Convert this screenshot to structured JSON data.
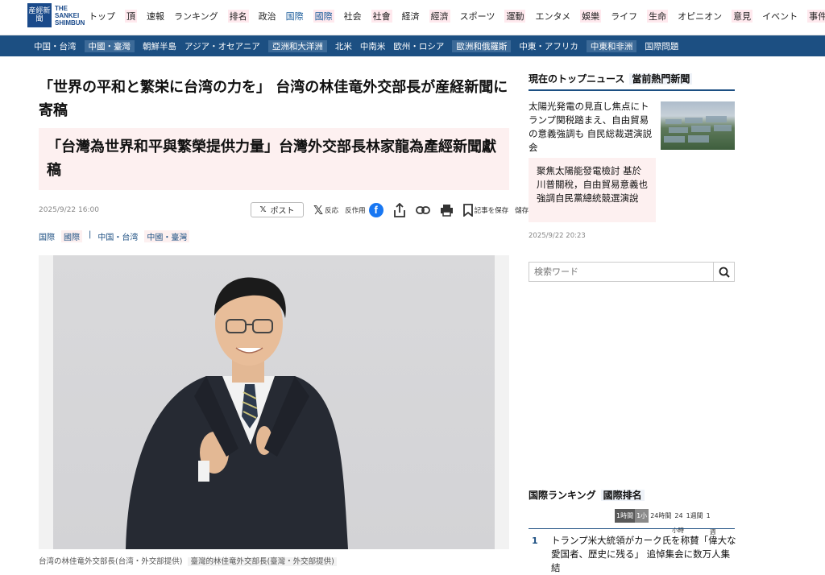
{
  "logo": {
    "kanji": "産經新聞",
    "en": [
      "THE",
      "SANKEI",
      "SHIMBUN"
    ]
  },
  "nav": [
    {
      "label": "トップ",
      "hl": false
    },
    {
      "label": "頂",
      "hl": true
    },
    {
      "label": "速報",
      "hl": false
    },
    {
      "label": "ランキング",
      "hl": false
    },
    {
      "label": "排名",
      "hl": true
    },
    {
      "label": "政治",
      "hl": false
    },
    {
      "label": "国際",
      "hl": false,
      "active": true
    },
    {
      "label": "國際",
      "hl": true,
      "active": true
    },
    {
      "label": "社会",
      "hl": false
    },
    {
      "label": "社會",
      "hl": true
    },
    {
      "label": "経済",
      "hl": false
    },
    {
      "label": "經濟",
      "hl": true
    },
    {
      "label": "スポーツ",
      "hl": false
    },
    {
      "label": "運動",
      "hl": true
    },
    {
      "label": "エンタメ",
      "hl": false
    },
    {
      "label": "娛樂",
      "hl": true
    },
    {
      "label": "ライフ",
      "hl": false
    },
    {
      "label": "生命",
      "hl": true
    },
    {
      "label": "オピニオン",
      "hl": false
    },
    {
      "label": "意見",
      "hl": true
    },
    {
      "label": "イベント",
      "hl": false
    },
    {
      "label": "事件",
      "hl": true
    }
  ],
  "subnav": [
    {
      "label": "中国・台湾",
      "hl": false
    },
    {
      "label": "中國・臺灣",
      "hl": true
    },
    {
      "label": "朝鮮半島",
      "hl": false
    },
    {
      "label": "アジア・オセアニア",
      "hl": false
    },
    {
      "label": "亞洲和大洋洲",
      "hl": true
    },
    {
      "label": "北米",
      "hl": false
    },
    {
      "label": "中南米",
      "hl": false
    },
    {
      "label": "欧州・ロシア",
      "hl": false
    },
    {
      "label": "歐洲和俄羅斯",
      "hl": true
    },
    {
      "label": "中東・アフリカ",
      "hl": false
    },
    {
      "label": "中東和非洲",
      "hl": true
    },
    {
      "label": "国際問題",
      "hl": false
    }
  ],
  "article": {
    "title_ja": "「世界の平和と繁栄に台湾の力を」 台湾の林佳竜外交部長が産経新聞に寄稿",
    "title_zh": "「台灣為世界和平與繁榮提供力量」台灣外交部長林家龍為產經新聞獻稿",
    "date": "2025/9/22 16:00",
    "share": {
      "post_label": "ポスト",
      "x_small": "反応",
      "x_reply": "反作用",
      "save_label": "記事を保存",
      "save_zh": "儲存文"
    },
    "tags": [
      {
        "label": "国際",
        "hl": false
      },
      {
        "label": "國際",
        "hl": true
      },
      {
        "label": "|",
        "hl": false
      },
      {
        "label": "中国・台湾",
        "hl": false
      },
      {
        "label": "中國・臺灣",
        "hl": true
      }
    ],
    "caption_ja": "台湾の林佳竜外交部長(台湾・外交部提供)",
    "caption_zh": "臺灣的林佳竜外交部長(臺灣・外交部提供)"
  },
  "sidebar": {
    "top_head_ja": "現在のトップニュース",
    "top_head_zh": "當前熱門新聞",
    "top_news_ja": "太陽光発電の見直し焦点にトランプ関税踏まえ、自由貿易の意義強調も 自民総裁選演説会",
    "top_news_zh": "聚焦太陽能發電檢討 基於川普關稅，自由貿易意義也強調自民黨總統競選演說",
    "top_date": "2025/9/22 20:23",
    "search_placeholder": "検索ワード",
    "rank_head_ja": "国際ランキング",
    "rank_head_zh": "國際排名",
    "rank_tabs": [
      {
        "label": "1時間",
        "state": "on"
      },
      {
        "label": "1小",
        "state": "on2"
      },
      {
        "label": "24時間",
        "state": ""
      },
      {
        "label": "24",
        "state": ""
      },
      {
        "label": "1週間",
        "state": ""
      },
      {
        "label": "1",
        "state": ""
      }
    ],
    "rank_tab_sub": {
      "a": "小時",
      "b": "週"
    },
    "rank1_num": "1",
    "rank1_text": "トランプ米大統領がカーク氏を称賛「偉大な愛国者、歴史に残る」 追悼集会に数万人集結"
  }
}
